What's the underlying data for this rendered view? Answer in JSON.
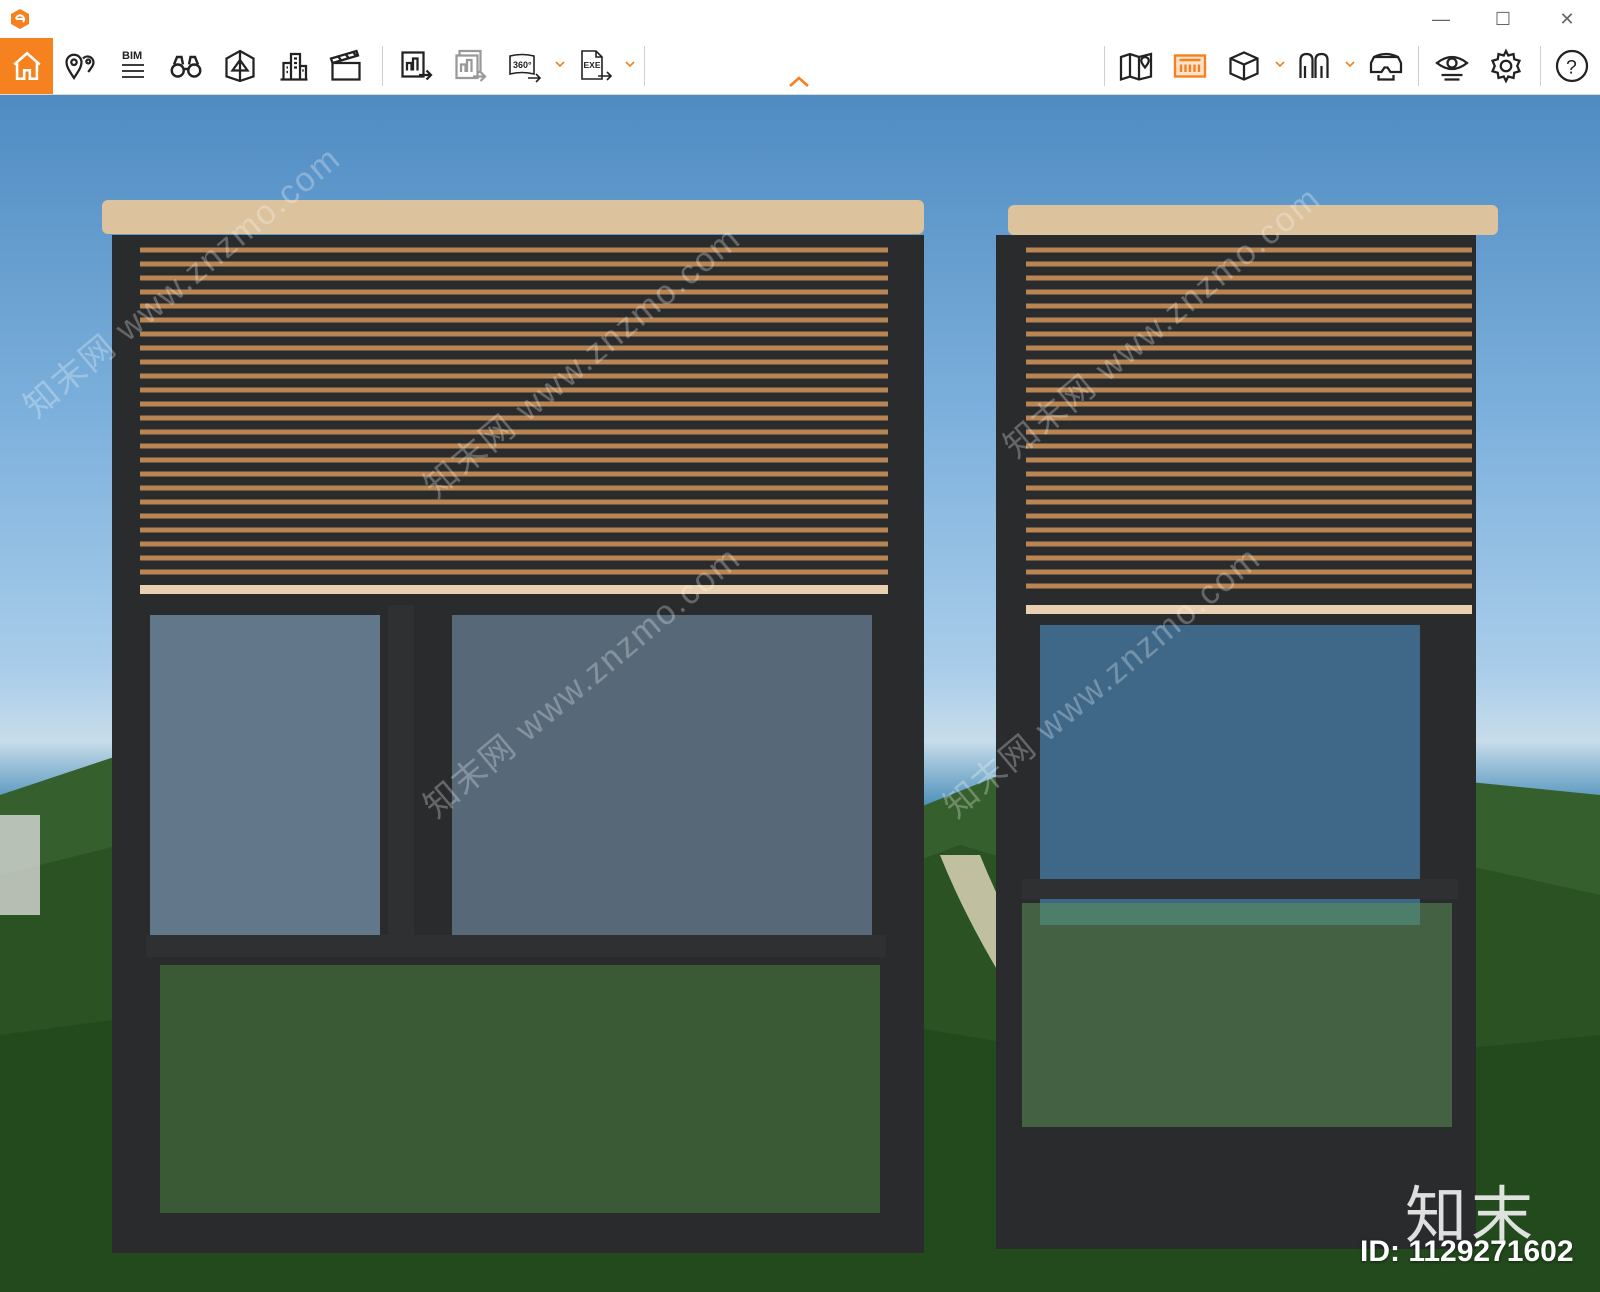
{
  "window": {
    "minimize_glyph": "—",
    "maximize_glyph": "☐",
    "close_glyph": "✕"
  },
  "toolbar": {
    "accent_color": "#f5821f",
    "left_tools": [
      {
        "name": "home",
        "icon": "home-icon"
      },
      {
        "name": "location",
        "icon": "map-pin-icon"
      },
      {
        "name": "bim",
        "icon": "bim-icon",
        "label": "BIM"
      },
      {
        "name": "binoculars",
        "icon": "binoculars-icon"
      },
      {
        "name": "building-perspective",
        "icon": "building-perspective-icon"
      },
      {
        "name": "buildings",
        "icon": "buildings-icon"
      },
      {
        "name": "clapperboard",
        "icon": "clapperboard-icon"
      },
      {
        "name": "export-image",
        "icon": "export-image-icon"
      },
      {
        "name": "export-batch",
        "icon": "export-batch-icon"
      },
      {
        "name": "export-360",
        "icon": "export-360-icon",
        "label": "360°"
      },
      {
        "name": "export-exe",
        "icon": "export-exe-icon",
        "label": "EXE"
      }
    ],
    "right_tools": [
      {
        "name": "map",
        "icon": "map-icon"
      },
      {
        "name": "plan-view",
        "icon": "plan-view-icon"
      },
      {
        "name": "cube",
        "icon": "cube-icon"
      },
      {
        "name": "walk-figures",
        "icon": "walk-figures-icon"
      },
      {
        "name": "vr-headset",
        "icon": "vr-headset-icon"
      },
      {
        "name": "visibility",
        "icon": "eye-icon"
      },
      {
        "name": "settings",
        "icon": "gear-icon"
      },
      {
        "name": "help",
        "icon": "help-icon",
        "label": "?"
      }
    ]
  },
  "viewport": {
    "brand_mark": "知末",
    "id_text": "ID: 1129271602",
    "watermark_text": "知末网 www.znzmo.com"
  }
}
